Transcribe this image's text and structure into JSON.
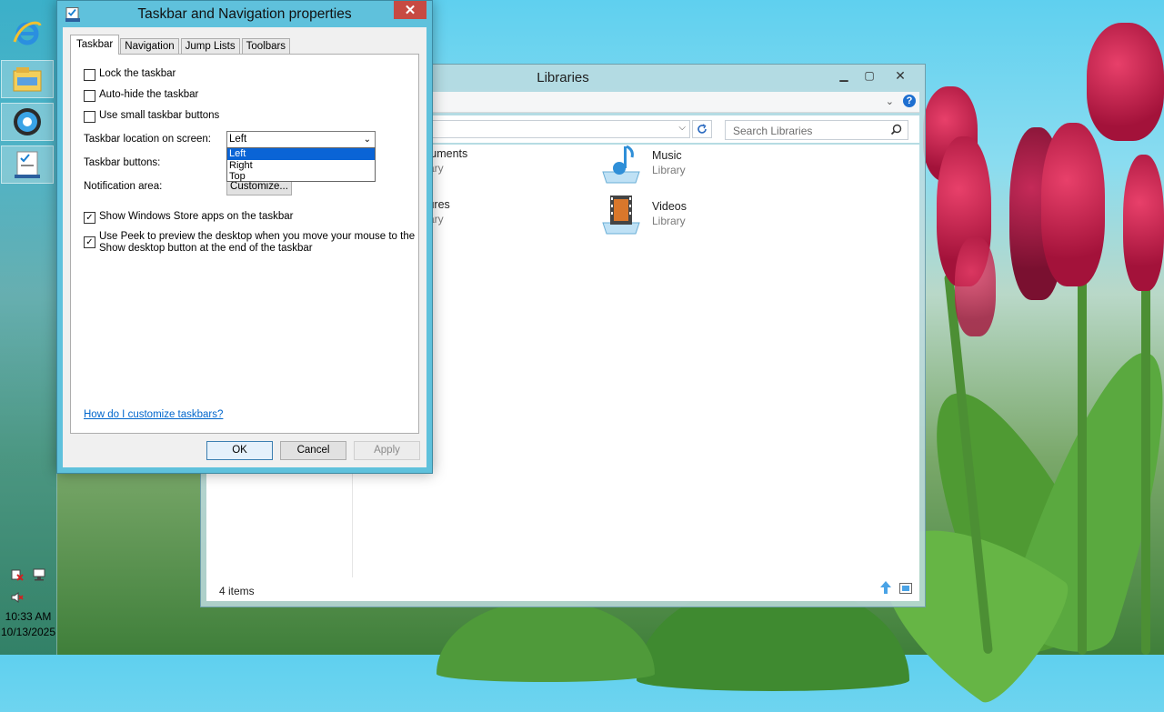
{
  "dialog": {
    "title": "Taskbar and Navigation properties",
    "close_glyph": "✕",
    "tabs": [
      "Taskbar",
      "Navigation",
      "Jump Lists",
      "Toolbars"
    ],
    "selected_tab": "Taskbar",
    "checkboxes": [
      {
        "label": "Lock the taskbar",
        "checked": false
      },
      {
        "label": "Auto-hide the taskbar",
        "checked": false
      },
      {
        "label": "Use small taskbar buttons",
        "checked": false
      },
      {
        "label": "Show Windows Store apps on the taskbar",
        "checked": true
      },
      {
        "label_line1": "Use Peek to preview the desktop when you move your mouse to the",
        "label_line2": "Show desktop button at the end of the taskbar",
        "checked": true
      }
    ],
    "location_label": "Taskbar location on screen:",
    "location_value": "Left",
    "location_options": [
      "Left",
      "Right",
      "Top"
    ],
    "buttons_label": "Taskbar buttons:",
    "notification_label": "Notification area:",
    "customize_button": "Customize...",
    "help_link": "How do I customize taskbars?",
    "ok": "OK",
    "cancel": "Cancel",
    "apply": "Apply"
  },
  "explorer": {
    "title": "Libraries",
    "search_placeholder": "Search Libraries",
    "items": [
      {
        "name": "cuments",
        "sub": "rary"
      },
      {
        "name": "Music",
        "sub": "Library"
      },
      {
        "name": "tures",
        "sub": "rary"
      },
      {
        "name": "Videos",
        "sub": "Library"
      }
    ],
    "status": "4 items"
  },
  "taskbar": {
    "time": "10:33 AM",
    "date": "10/13/2025",
    "apps": [
      "internet-explorer",
      "file-explorer",
      "browser",
      "taskbar-properties"
    ]
  },
  "colors": {
    "accent": "#5fc1dc",
    "close": "#c74a42",
    "link": "#0066cc",
    "selection": "#0a64d6"
  }
}
